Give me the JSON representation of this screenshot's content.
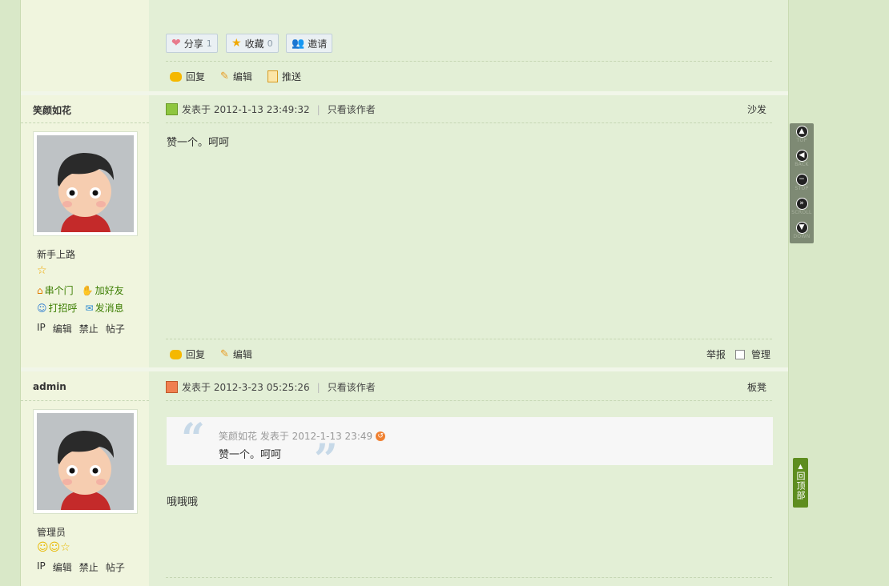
{
  "top_post": {
    "share": {
      "label": "分享",
      "count": "1"
    },
    "favorite": {
      "label": "收藏",
      "count": "0"
    },
    "invite": {
      "label": "邀请"
    },
    "actions": {
      "reply": "回复",
      "edit": "编辑",
      "push": "推送"
    }
  },
  "post1": {
    "username": "笑颜如花",
    "posted_at": "发表于 2012-1-13 23:49:32",
    "only_author": "只看该作者",
    "floor": "沙发",
    "content": "赞一个。呵呵",
    "usergroup": "新手上路",
    "links": {
      "home": "串个门",
      "add_friend": "加好友",
      "greet": "打招呼",
      "message": "发消息"
    },
    "admin_links": [
      "IP",
      "编辑",
      "禁止",
      "帖子"
    ],
    "actions": {
      "reply": "回复",
      "edit": "编辑",
      "report": "举报",
      "manage": "管理"
    }
  },
  "post2": {
    "username": "admin",
    "posted_at": "发表于 2012-3-23 05:25:26",
    "only_author": "只看该作者",
    "floor": "板凳",
    "quote": {
      "author_line": "笑颜如花 发表于 2012-1-13 23:49",
      "text": "赞一个。呵呵"
    },
    "content": "哦哦哦",
    "usergroup": "管理员",
    "admin_links": [
      "IP",
      "编辑",
      "禁止",
      "帖子"
    ]
  },
  "back_to_top": "回顶部",
  "scroll_panel": [
    "TOP",
    "BACK",
    "STOP",
    "SCROLL",
    "DOWN"
  ]
}
